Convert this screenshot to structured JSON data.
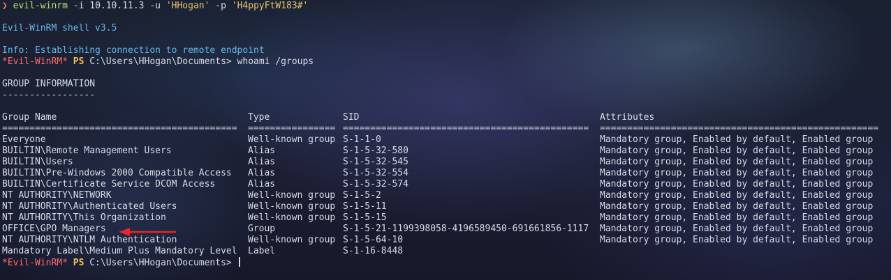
{
  "prompt": {
    "symbol": "❯",
    "command": "evil-winrm",
    "args_1": " -i 10.10.11.3 -u ",
    "user": "'HHogan'",
    "args_2": " -p ",
    "password": "'H4ppyFtW183#'"
  },
  "banner": "Evil-WinRM shell v3.5",
  "info": "Info: Establishing connection to remote endpoint",
  "shell_prompt": {
    "label": "*Evil-WinRM*",
    "ps": "PS",
    "path": "C:\\Users\\HHogan\\Documents>"
  },
  "command1": " whoami /groups",
  "section_title": "GROUP INFORMATION",
  "section_underline": "-----------------",
  "headers": {
    "name": "Group Name",
    "type": "Type",
    "sid": "SID",
    "attr": "Attributes"
  },
  "separators": {
    "name": "===========================================",
    "type": "================",
    "sid": "=============================================",
    "attr": "==================================================="
  },
  "rows": [
    {
      "name": "Everyone",
      "type": "Well-known group",
      "sid": "S-1-1-0",
      "attr": "Mandatory group, Enabled by default, Enabled group"
    },
    {
      "name": "BUILTIN\\Remote Management Users",
      "type": "Alias",
      "sid": "S-1-5-32-580",
      "attr": "Mandatory group, Enabled by default, Enabled group"
    },
    {
      "name": "BUILTIN\\Users",
      "type": "Alias",
      "sid": "S-1-5-32-545",
      "attr": "Mandatory group, Enabled by default, Enabled group"
    },
    {
      "name": "BUILTIN\\Pre-Windows 2000 Compatible Access",
      "type": "Alias",
      "sid": "S-1-5-32-554",
      "attr": "Mandatory group, Enabled by default, Enabled group"
    },
    {
      "name": "BUILTIN\\Certificate Service DCOM Access",
      "type": "Alias",
      "sid": "S-1-5-32-574",
      "attr": "Mandatory group, Enabled by default, Enabled group"
    },
    {
      "name": "NT AUTHORITY\\NETWORK",
      "type": "Well-known group",
      "sid": "S-1-5-2",
      "attr": "Mandatory group, Enabled by default, Enabled group"
    },
    {
      "name": "NT AUTHORITY\\Authenticated Users",
      "type": "Well-known group",
      "sid": "S-1-5-11",
      "attr": "Mandatory group, Enabled by default, Enabled group"
    },
    {
      "name": "NT AUTHORITY\\This Organization",
      "type": "Well-known group",
      "sid": "S-1-5-15",
      "attr": "Mandatory group, Enabled by default, Enabled group"
    },
    {
      "name": "OFFICE\\GPO Managers",
      "type": "Group",
      "sid": "S-1-5-21-1199398058-4196589450-691661856-1117",
      "attr": "Mandatory group, Enabled by default, Enabled group"
    },
    {
      "name": "NT AUTHORITY\\NTLM Authentication",
      "type": "Well-known group",
      "sid": "S-1-5-64-10",
      "attr": "Mandatory group, Enabled by default, Enabled group"
    },
    {
      "name": "Mandatory Label\\Medium Plus Mandatory Level",
      "type": "Label",
      "sid": "S-1-16-8448",
      "attr": ""
    }
  ],
  "colors": {
    "prompt_red": "#ff6b6b",
    "command_green": "#b7e07a",
    "string_yellow": "#e6c46a",
    "info_blue": "#67b7e8",
    "ps_gold": "#f3c15a",
    "arrow_red": "#e8262b"
  },
  "annotation_icon": "red-arrow-icon"
}
